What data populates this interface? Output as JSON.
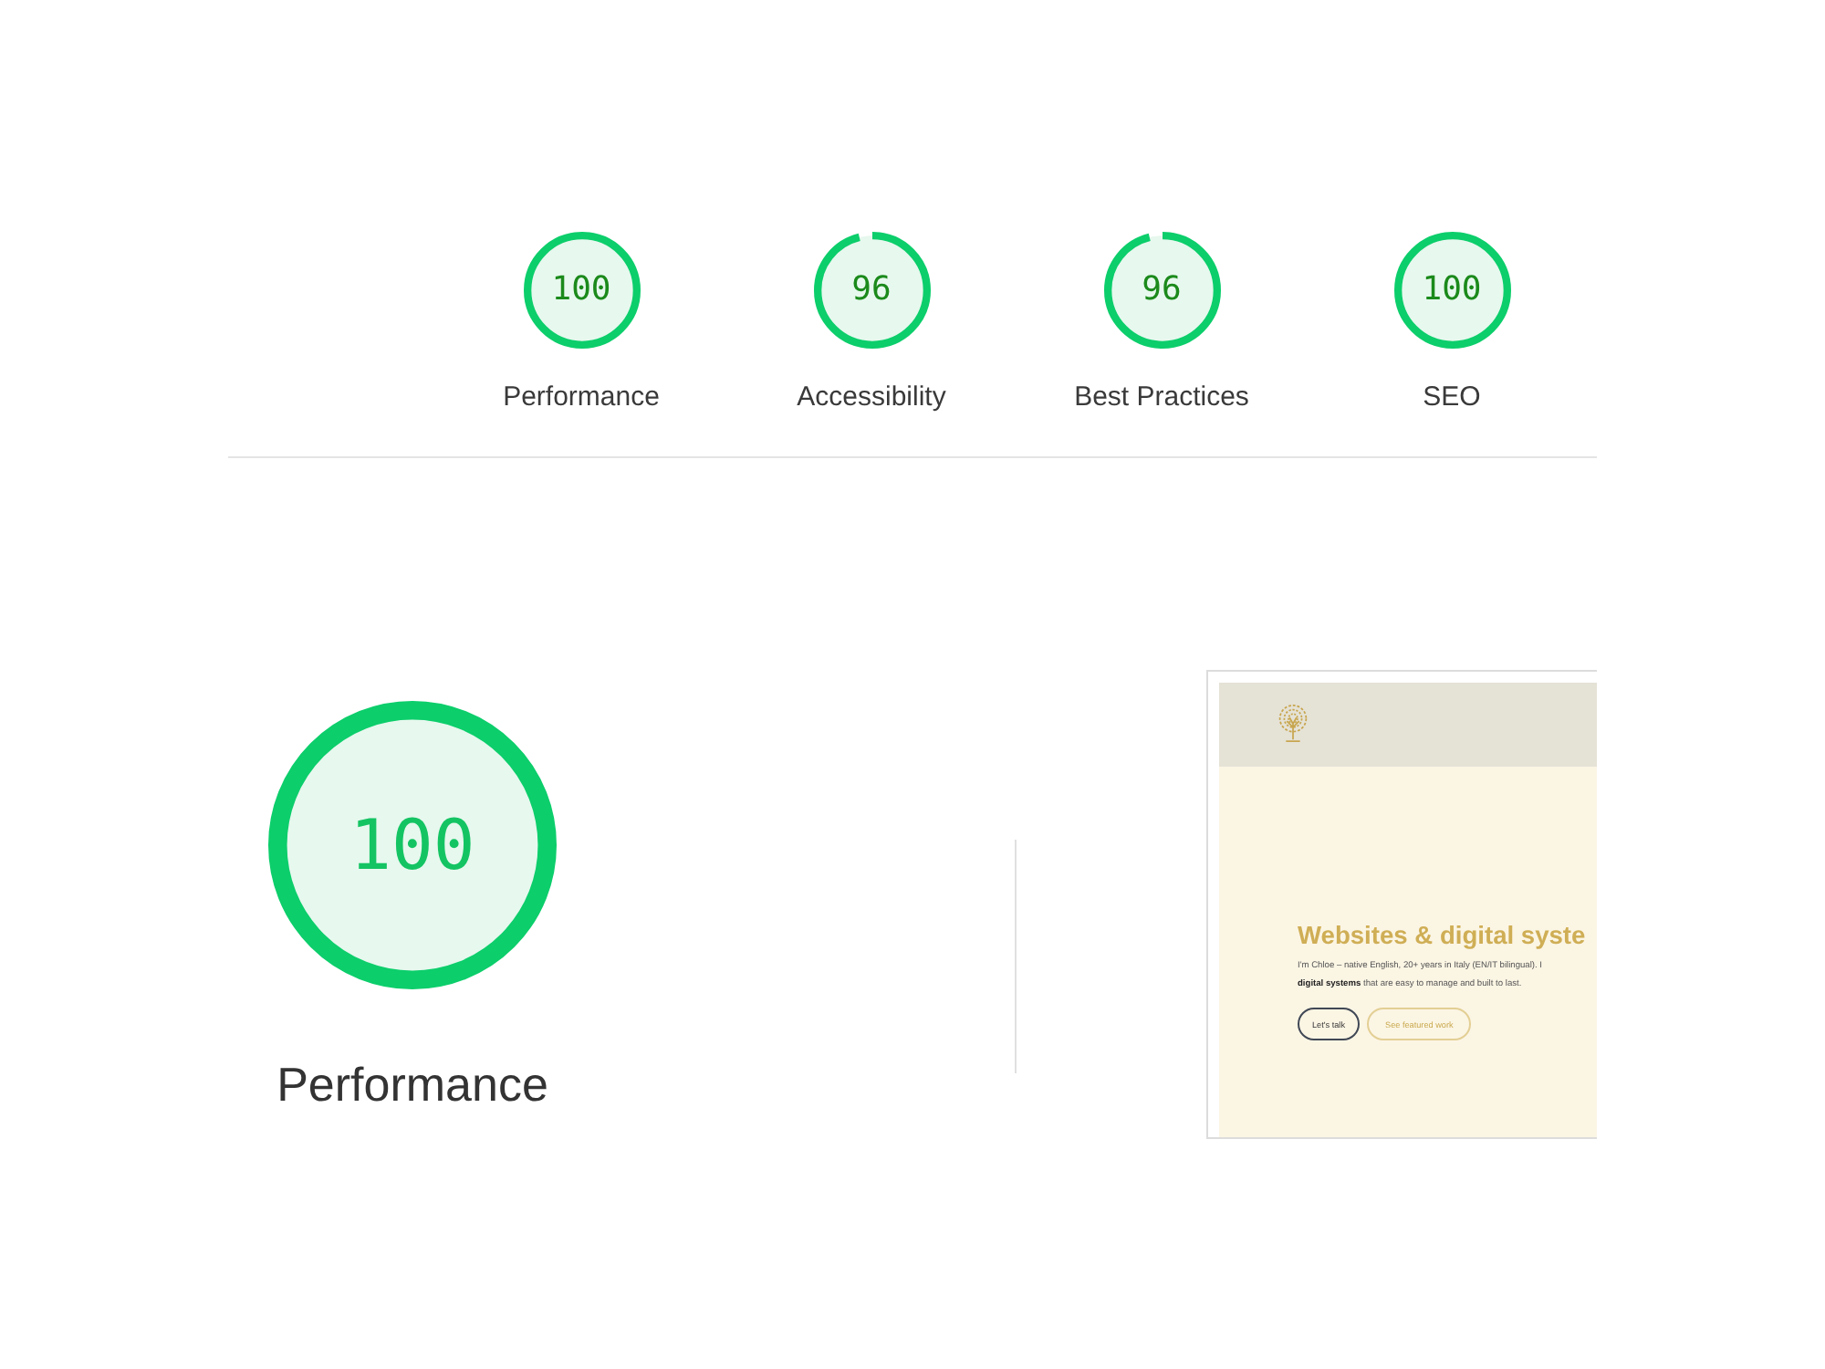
{
  "categories": [
    {
      "title": "Performance",
      "score": "100",
      "level": 1
    },
    {
      "title": "Accessibility",
      "score": "96",
      "level": 0.96
    },
    {
      "title": "Best Practices",
      "score": "96",
      "level": 0.96
    },
    {
      "title": "SEO",
      "score": "100",
      "level": 1
    }
  ],
  "performance": {
    "title": "Performance",
    "score": "100",
    "level": 1
  },
  "screenshot": {
    "heading": "Websites & digital syste",
    "intro": [
      "I'm Chloe – native English, 20+ years in Italy (EN/IT bilingual). I",
      "**digital systems** that are easy to manage and built to last."
    ],
    "buttons": [
      {
        "label": "Let's talk",
        "kind": "primary"
      },
      {
        "label": "See featured work",
        "kind": "secondary"
      }
    ]
  }
}
